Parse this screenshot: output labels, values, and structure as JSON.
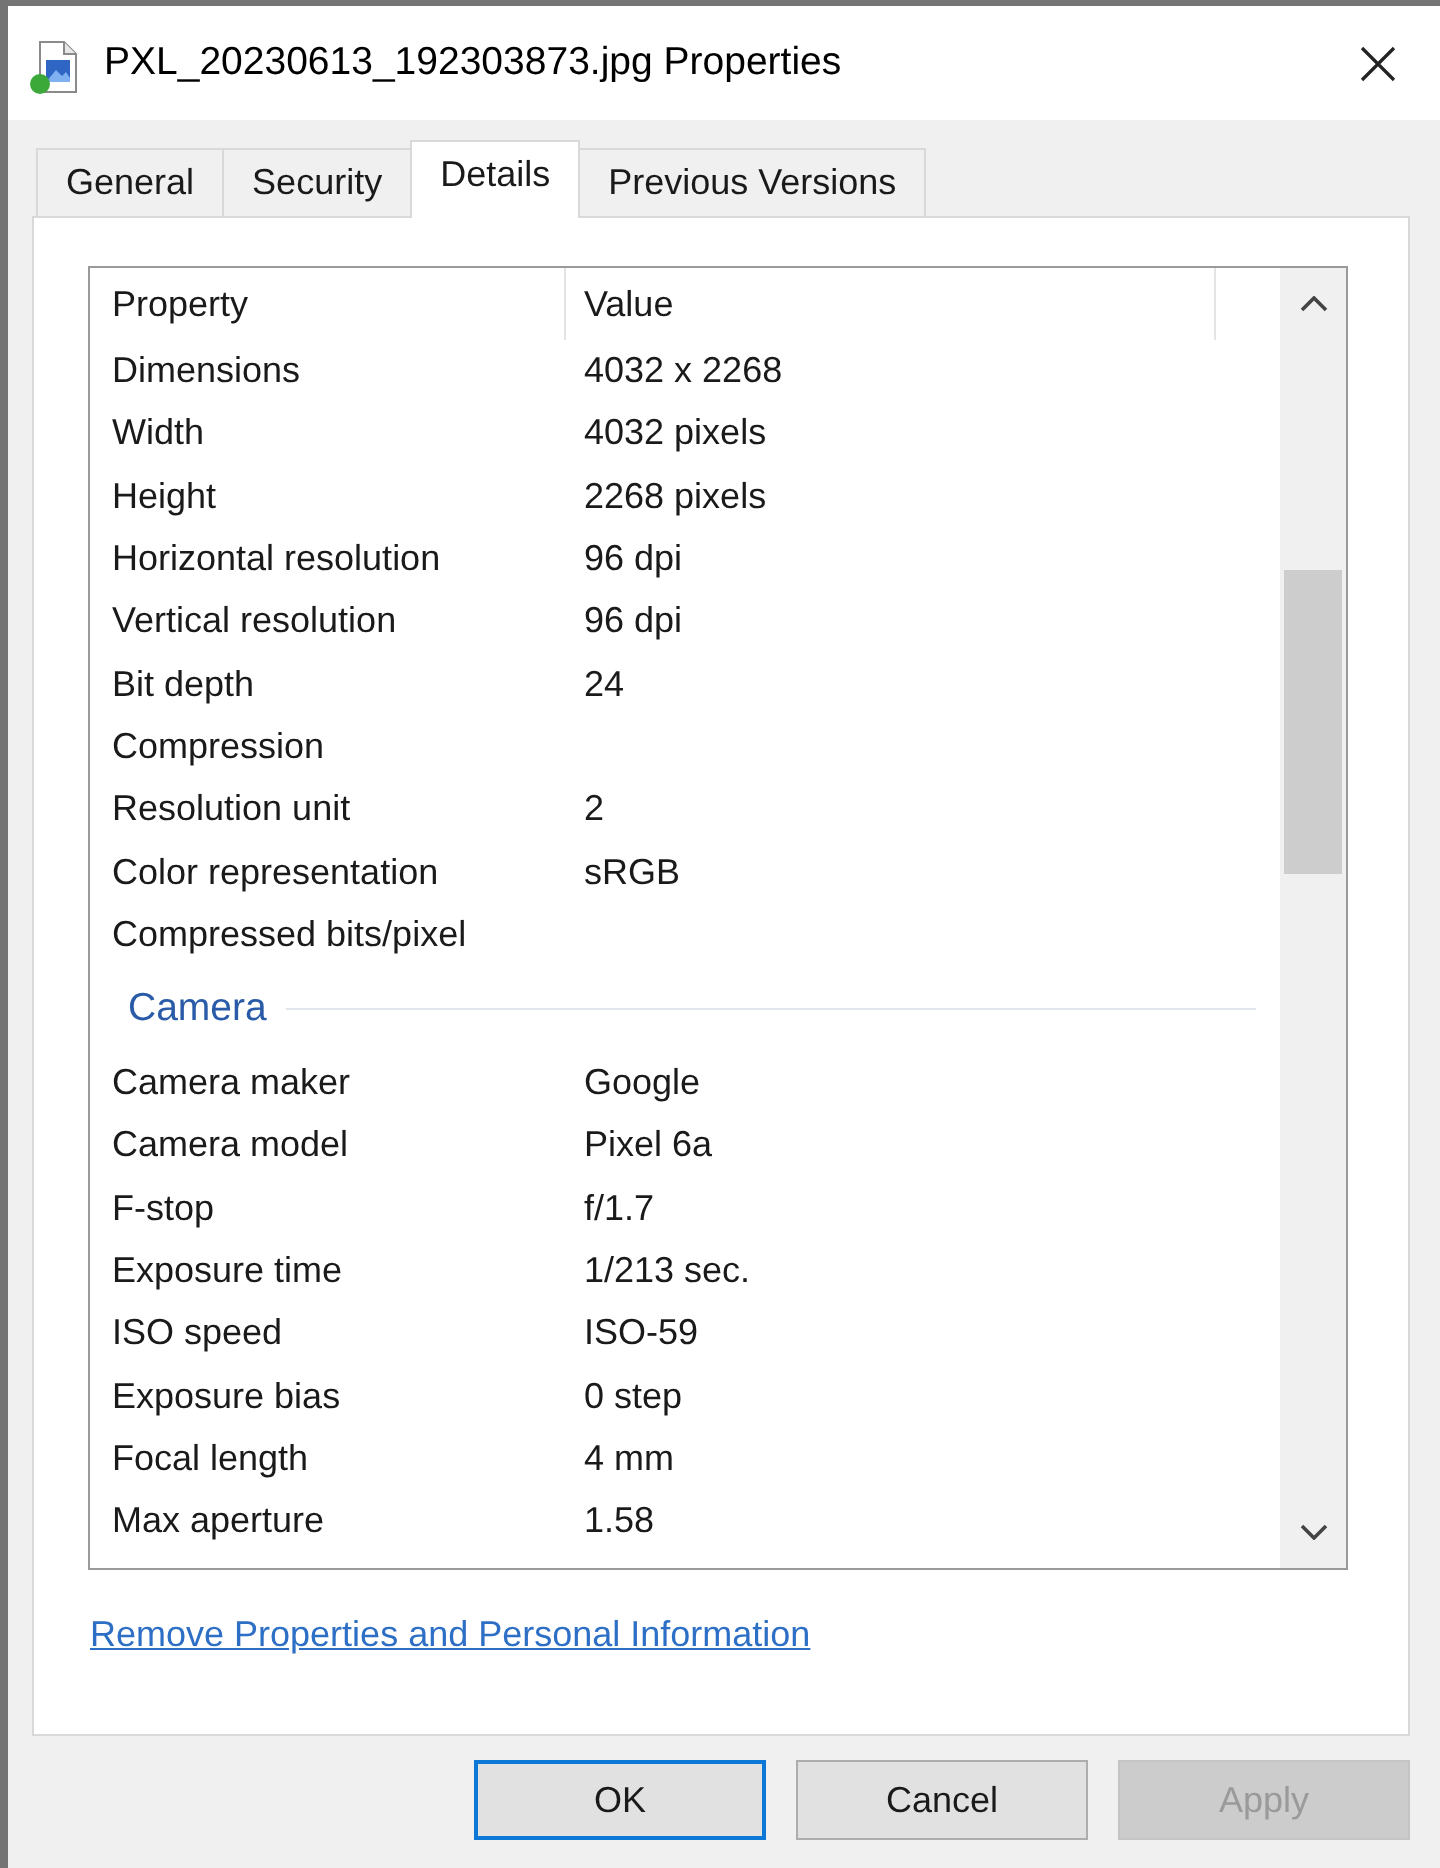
{
  "window": {
    "title": "PXL_20230613_192303873.jpg Properties"
  },
  "tabs": [
    {
      "label": "General",
      "selected": false
    },
    {
      "label": "Security",
      "selected": false
    },
    {
      "label": "Details",
      "selected": true
    },
    {
      "label": "Previous Versions",
      "selected": false
    }
  ],
  "details": {
    "columns": [
      "Property",
      "Value"
    ],
    "rows": [
      {
        "kind": "row",
        "property": "Dimensions",
        "value": "4032 x 2268"
      },
      {
        "kind": "row",
        "property": "Width",
        "value": "4032 pixels"
      },
      {
        "kind": "row",
        "property": "Height",
        "value": "2268 pixels"
      },
      {
        "kind": "row",
        "property": "Horizontal resolution",
        "value": "96 dpi"
      },
      {
        "kind": "row",
        "property": "Vertical resolution",
        "value": "96 dpi"
      },
      {
        "kind": "row",
        "property": "Bit depth",
        "value": "24"
      },
      {
        "kind": "row",
        "property": "Compression"
      },
      {
        "kind": "row",
        "property": "Resolution unit",
        "value": "2"
      },
      {
        "kind": "row",
        "property": "Color representation",
        "value": "sRGB"
      },
      {
        "kind": "row",
        "property": "Compressed bits/pixel"
      },
      {
        "kind": "section",
        "title": "Camera"
      },
      {
        "kind": "row",
        "property": "Camera maker",
        "value": "Google"
      },
      {
        "kind": "row",
        "property": "Camera model",
        "value": "Pixel 6a"
      },
      {
        "kind": "row",
        "property": "F-stop",
        "value": "f/1.7"
      },
      {
        "kind": "row",
        "property": "Exposure time",
        "value": "1/213 sec."
      },
      {
        "kind": "row",
        "property": "ISO speed",
        "value": "ISO-59"
      },
      {
        "kind": "row",
        "property": "Exposure bias",
        "value": "0 step"
      },
      {
        "kind": "row",
        "property": "Focal length",
        "value": "4 mm"
      },
      {
        "kind": "row",
        "property": "Max aperture",
        "value": "1.58"
      }
    ]
  },
  "link": "Remove Properties and Personal Information",
  "buttons": [
    {
      "label": "OK",
      "focused": true,
      "disabled": false
    },
    {
      "label": "Cancel",
      "focused": false,
      "disabled": false
    },
    {
      "label": "Apply",
      "focused": false,
      "disabled": true
    }
  ]
}
